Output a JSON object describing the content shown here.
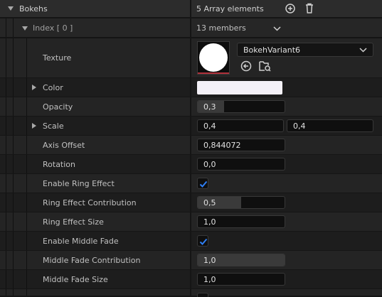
{
  "array": {
    "name": "Bokehs",
    "summary": "5 Array elements"
  },
  "element": {
    "name": "Index [ 0 ]",
    "summary": "13 members"
  },
  "texture": {
    "label": "Texture",
    "asset": "BokehVariant6"
  },
  "rows": {
    "color": {
      "label": "Color",
      "value_color": "#f4f1f8"
    },
    "opacity": {
      "label": "Opacity",
      "value": "0,3",
      "fill_fraction": 0.3
    },
    "scale": {
      "label": "Scale",
      "x": "0,4",
      "y": "0,4"
    },
    "axis_offset": {
      "label": "Axis Offset",
      "value": "0,844072"
    },
    "rotation": {
      "label": "Rotation",
      "value": "0,0"
    },
    "enable_ring": {
      "label": "Enable Ring Effect",
      "checked": true
    },
    "ring_contribution": {
      "label": "Ring Effect Contribution",
      "value": "0,5",
      "fill_fraction": 0.5
    },
    "ring_size": {
      "label": "Ring Effect Size",
      "value": "1,0"
    },
    "enable_middle_fade": {
      "label": "Enable Middle Fade",
      "checked": true
    },
    "middle_fade_contribution": {
      "label": "Middle Fade Contribution",
      "value": "1,0"
    },
    "middle_fade_size": {
      "label": "Middle Fade Size",
      "value": "1,0"
    }
  },
  "colors": {
    "accent_check": "#2f7ff4",
    "row_bg": "#242424",
    "header_bg": "#2c2c2c"
  }
}
